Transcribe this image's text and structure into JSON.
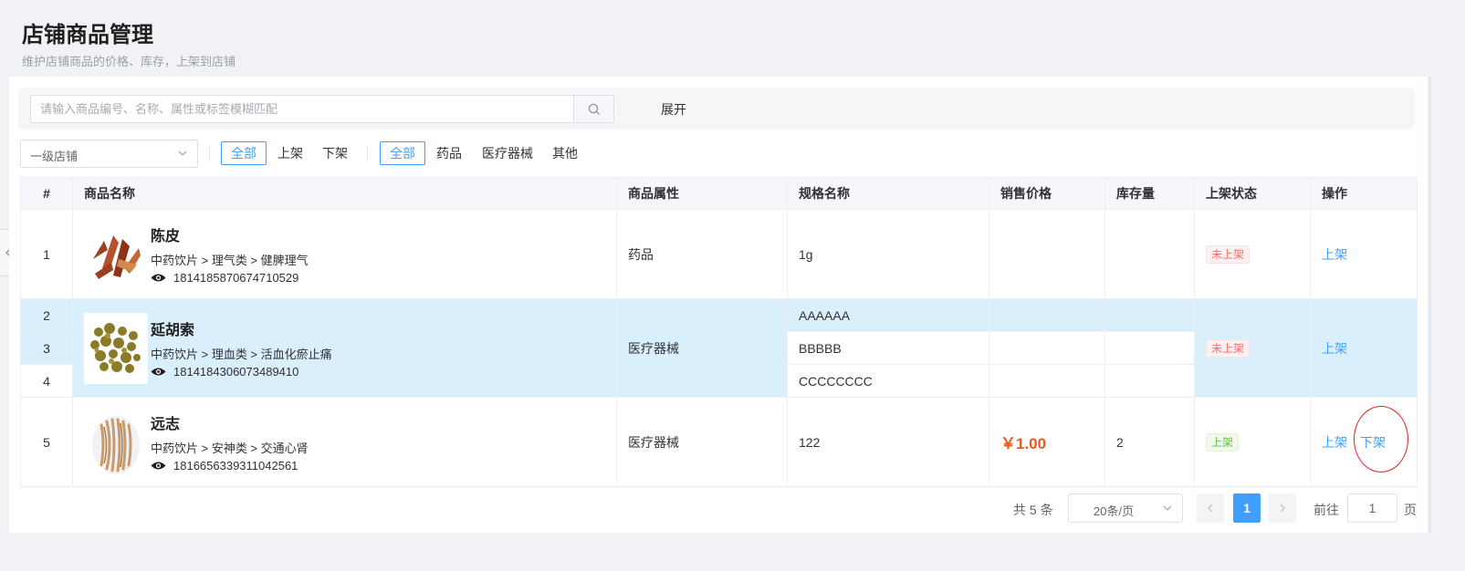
{
  "header": {
    "title": "店铺商品管理",
    "subtitle": "维护店铺商品的价格、库存，上架到店铺"
  },
  "search": {
    "placeholder": "请输入商品编号、名称、属性或标签模糊匹配",
    "value": "",
    "expand_label": "展开"
  },
  "filters": {
    "store_select": "一级店铺",
    "status_buttons": [
      "全部",
      "上架",
      "下架"
    ],
    "status_active": "全部",
    "type_buttons": [
      "全部",
      "药品",
      "医疗器械",
      "其他"
    ],
    "type_active": "全部"
  },
  "table": {
    "columns": [
      "#",
      "商品名称",
      "商品属性",
      "规格名称",
      "销售价格",
      "库存量",
      "上架状态",
      "操作"
    ],
    "products": [
      {
        "name": "陈皮",
        "category": "中药饮片 > 理气类 > 健脾理气",
        "code": "1814185870674710529",
        "attribute": "药品",
        "status": "未上架",
        "actions": [
          "上架"
        ],
        "specs": [
          {
            "index": "1",
            "spec": "1g",
            "price": "",
            "stock": ""
          }
        ]
      },
      {
        "name": "延胡索",
        "category": "中药饮片 > 理血类 > 活血化瘀止痛",
        "code": "1814184306073489410",
        "attribute": "医疗器械",
        "status": "未上架",
        "actions": [
          "上架"
        ],
        "specs": [
          {
            "index": "2",
            "spec": "AAAAAA",
            "price": "",
            "stock": ""
          },
          {
            "index": "3",
            "spec": "BBBBB",
            "price": "",
            "stock": ""
          },
          {
            "index": "4",
            "spec": "CCCCCCCC",
            "price": "",
            "stock": ""
          }
        ]
      },
      {
        "name": "远志",
        "category": "中药饮片 > 安神类 > 交通心肾",
        "code": "1816656339311042561",
        "attribute": "医疗器械",
        "status": "上架",
        "actions": [
          "上架",
          "下架"
        ],
        "specs": [
          {
            "index": "5",
            "spec": "122",
            "price": "￥1.00",
            "stock": "2"
          }
        ]
      }
    ]
  },
  "pagination": {
    "total": "共 5 条",
    "page_size": "20条/页",
    "current_page": "1",
    "goto_label": "前往",
    "goto_value": "1",
    "goto_suffix": "页"
  },
  "colors": {
    "primary": "#409eff",
    "highlight_row": "#d9effb",
    "price": "#f2561d",
    "tag_off": "#f56c6c",
    "tag_on": "#67c23a",
    "annotation_circle": "#e02020"
  },
  "icons": [
    "search-icon",
    "chevron-down-icon",
    "eye-icon",
    "chevron-left-icon",
    "chevron-right-icon"
  ]
}
